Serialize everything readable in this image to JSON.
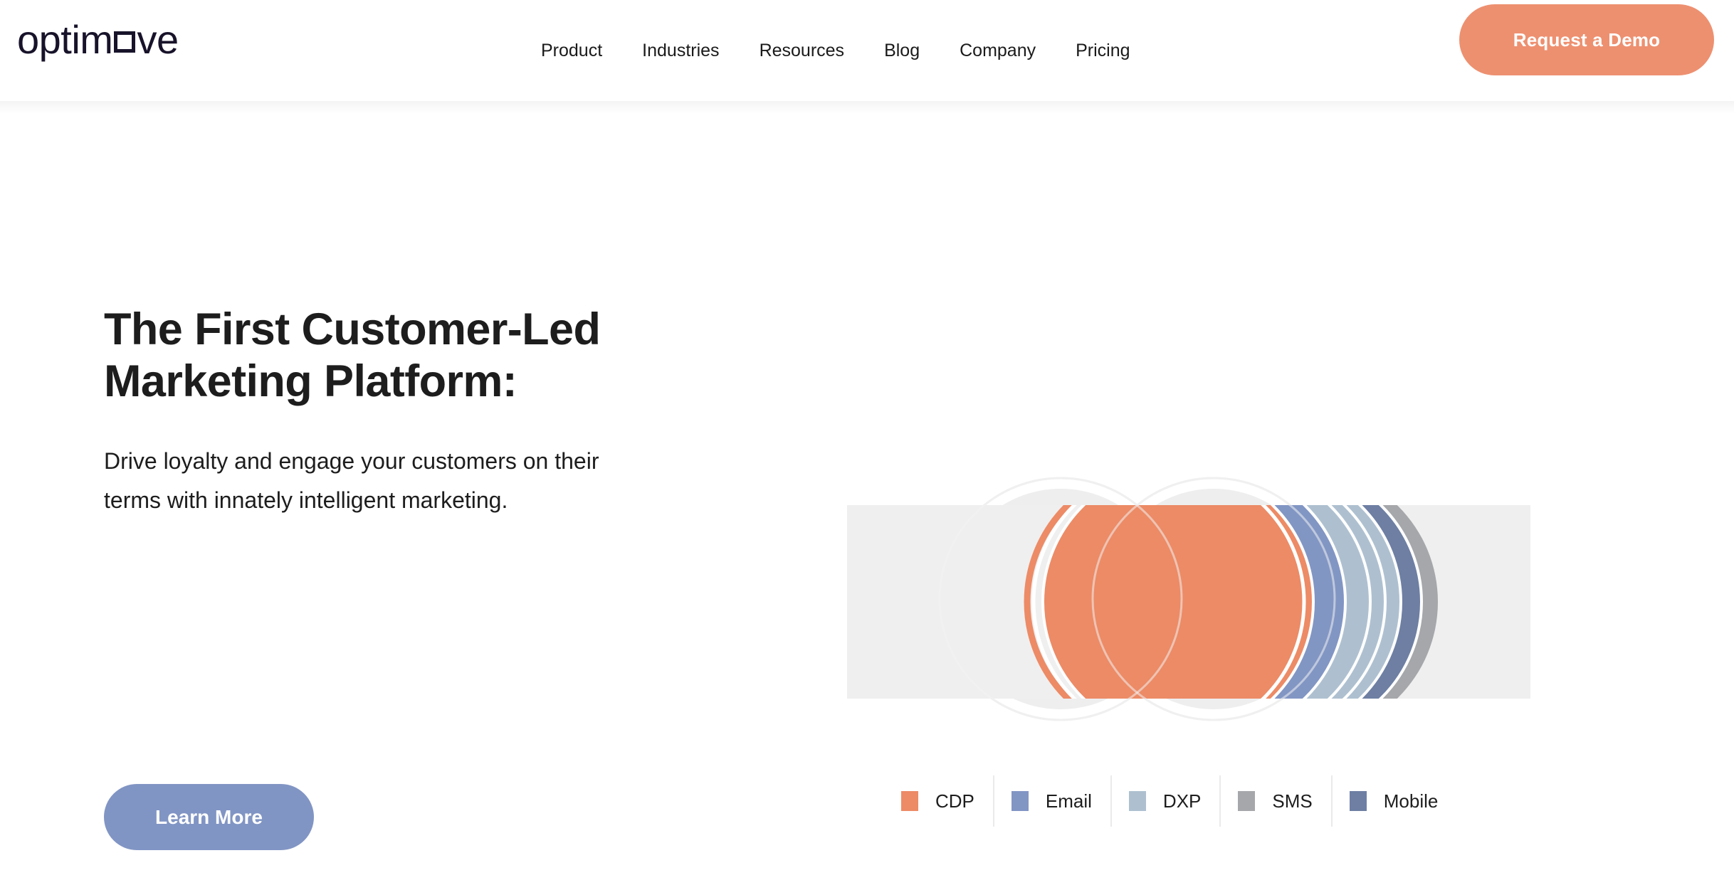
{
  "header": {
    "logo": {
      "name": "optimove",
      "text_before": "optim",
      "square_icon": "square-glyph",
      "text_after": "ve"
    },
    "nav": [
      {
        "label": "Product"
      },
      {
        "label": "Industries"
      },
      {
        "label": "Resources"
      },
      {
        "label": "Blog"
      },
      {
        "label": "Company"
      },
      {
        "label": "Pricing"
      }
    ],
    "cta": {
      "label": "Request a Demo",
      "color": "#ed9070"
    }
  },
  "hero": {
    "title": "The First Customer-Led Marketing Platform:",
    "subtitle": "Drive loyalty and engage your customers on their terms with innately intelligent marketing.",
    "cta": {
      "label": "Learn More",
      "color": "#8195c4"
    }
  },
  "chart_data": {
    "type": "diagram",
    "title": "",
    "legend_position": "bottom",
    "categories": [
      "CDP",
      "Email",
      "DXP",
      "SMS",
      "Mobile"
    ],
    "colors": {
      "CDP": "#ec8b66",
      "Email": "#8296c4",
      "DXP": "#aec0d0",
      "SMS": "#a5a7aa",
      "Mobile": "#6e7fa3"
    },
    "background": {
      "band_color": "#efefef",
      "circle_fill": "#eeeeee",
      "circle_outline": "#ececec"
    },
    "series": [
      {
        "name": "CDP",
        "color": "#ec8b66",
        "order": 1
      },
      {
        "name": "Email",
        "color": "#8296c4",
        "order": 2
      },
      {
        "name": "DXP",
        "color": "#aec0d0",
        "order": 3
      },
      {
        "name": "SMS",
        "color": "#a5a7aa",
        "order": 4
      },
      {
        "name": "Mobile",
        "color": "#6e7fa3",
        "order": 5
      }
    ]
  },
  "legend": {
    "items": [
      {
        "label": "CDP",
        "color": "#ec8b66"
      },
      {
        "label": "Email",
        "color": "#8296c4"
      },
      {
        "label": "DXP",
        "color": "#aec0d0"
      },
      {
        "label": "SMS",
        "color": "#a5a7aa"
      },
      {
        "label": "Mobile",
        "color": "#6e7fa3"
      }
    ]
  }
}
